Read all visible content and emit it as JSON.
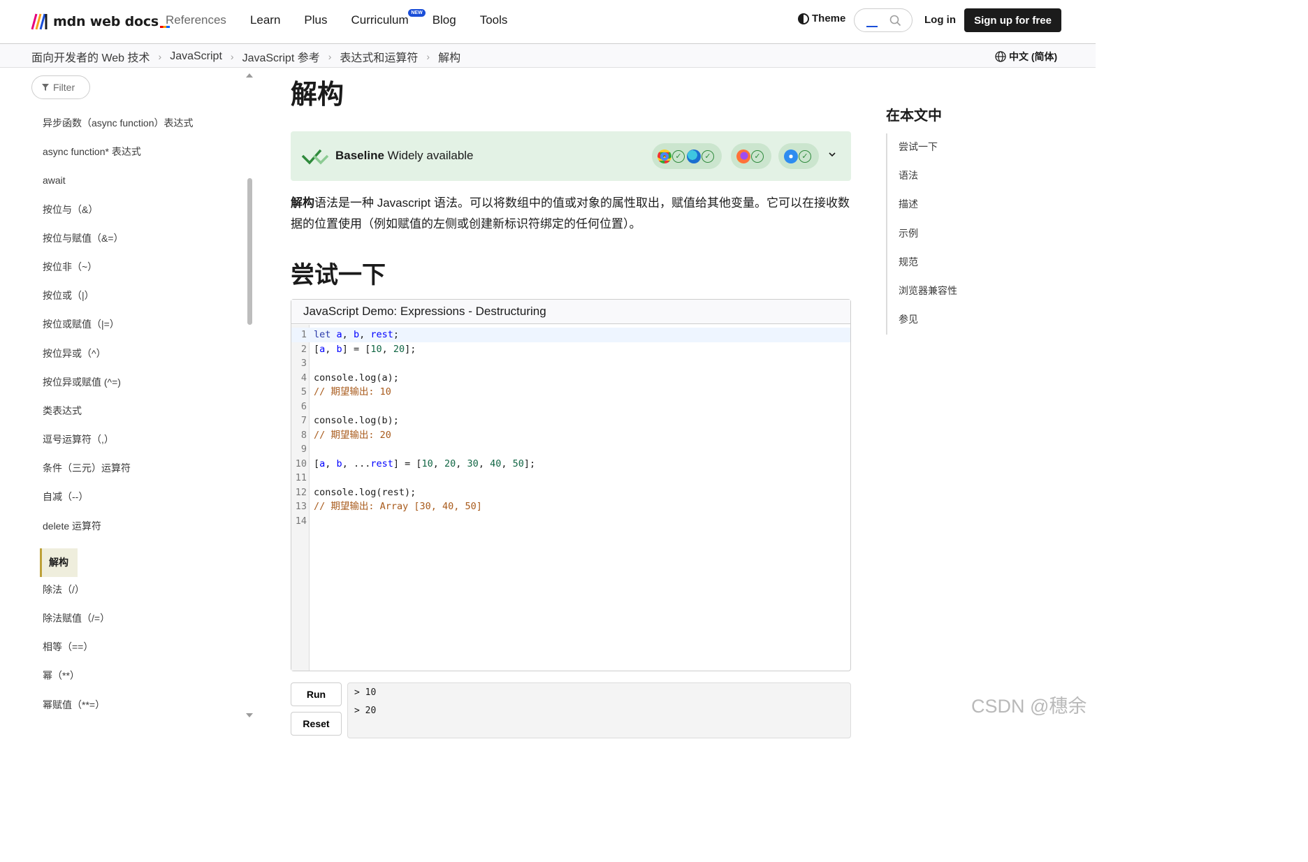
{
  "header": {
    "logo_text": "mdn web docs",
    "nav": [
      "References",
      "Learn",
      "Plus",
      "Curriculum",
      "Blog",
      "Tools"
    ],
    "new_badge": "NEW",
    "theme_label": "Theme",
    "login_label": "Log in",
    "signup_label": "Sign up for free"
  },
  "breadcrumb": [
    "面向开发者的 Web 技术",
    "JavaScript",
    "JavaScript 参考",
    "表达式和运算符",
    "解构"
  ],
  "language": "中文 (简体)",
  "sidebar": {
    "filter_placeholder": "Filter",
    "items": [
      "异步函数（async function）表达式",
      "async function* 表达式",
      "await",
      "按位与（&）",
      "按位与赋值（&=）",
      "按位非（~）",
      "按位或（|）",
      "按位或赋值（|=）",
      "按位异或（^）",
      "按位异或赋值 (^=)",
      "类表达式",
      "逗号运算符（,）",
      "条件（三元）运算符",
      "自减（--）",
      "delete 运算符",
      "解构",
      "除法（/）",
      "除法赋值（/=）",
      "相等（==）",
      "幂（**）",
      "幂赋值（**=）"
    ],
    "active_index": 15
  },
  "main": {
    "title": "解构",
    "baseline": {
      "label": "Baseline",
      "status": "Widely available"
    },
    "lead_bold": "解构",
    "lead_rest": "语法是一种 Javascript 语法。可以将数组中的值或对象的属性取出，赋值给其他变量。它可以在接收数据的位置使用（例如赋值的左侧或创建新标识符绑定的任何位置）。",
    "section_title": "尝试一下",
    "demo": {
      "title": "JavaScript Demo: Expressions - Destructuring",
      "line_numbers": [
        "1",
        "2",
        "3",
        "4",
        "5",
        "6",
        "7",
        "8",
        "9",
        "10",
        "11",
        "12",
        "13",
        "14"
      ],
      "run_label": "Run",
      "reset_label": "Reset",
      "console": [
        "> 10",
        "> 20"
      ]
    }
  },
  "toc": {
    "title": "在本文中",
    "items": [
      "尝试一下",
      "语法",
      "描述",
      "示例",
      "规范",
      "浏览器兼容性",
      "参见"
    ]
  },
  "watermark": "CSDN @穗余",
  "colors": {
    "baseline_bg": "#e3f2e5",
    "active_sidebar": "#efeedd",
    "signup_bg": "#1b1b1b"
  }
}
